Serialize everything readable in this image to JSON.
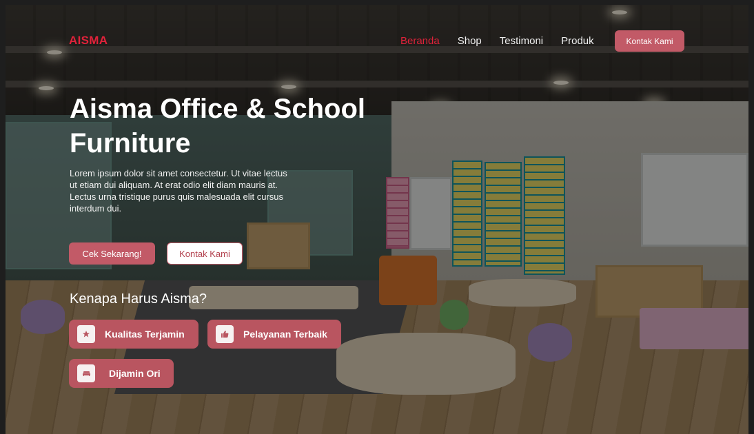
{
  "brand": {
    "logo": "AISMA",
    "accent": "#e0223a",
    "button_color": "#c25a67"
  },
  "nav": {
    "items": [
      {
        "label": "Beranda",
        "active": true
      },
      {
        "label": "Shop",
        "active": false
      },
      {
        "label": "Testimoni",
        "active": false
      },
      {
        "label": "Produk",
        "active": false
      }
    ],
    "cta": "Kontak Kami"
  },
  "hero": {
    "title_line1": "Aisma Office & School",
    "title_line2": "Furniture",
    "description": "Lorem ipsum dolor sit amet consectetur. Ut vitae lectus ut etiam dui aliquam. At erat odio elit diam mauris at. Lectus urna tristique purus quis malesuada elit cursus interdum dui.",
    "primary_button": "Cek Sekarang!",
    "secondary_button": "Kontak Kami"
  },
  "why": {
    "title": "Kenapa Harus Aisma?",
    "features": [
      {
        "label": "Kualitas Terjamin",
        "icon": "star-icon"
      },
      {
        "label": "Pelayanan Terbaik",
        "icon": "thumbs-up-icon"
      },
      {
        "label": "Dijamin Ori",
        "icon": "sofa-icon"
      }
    ]
  }
}
